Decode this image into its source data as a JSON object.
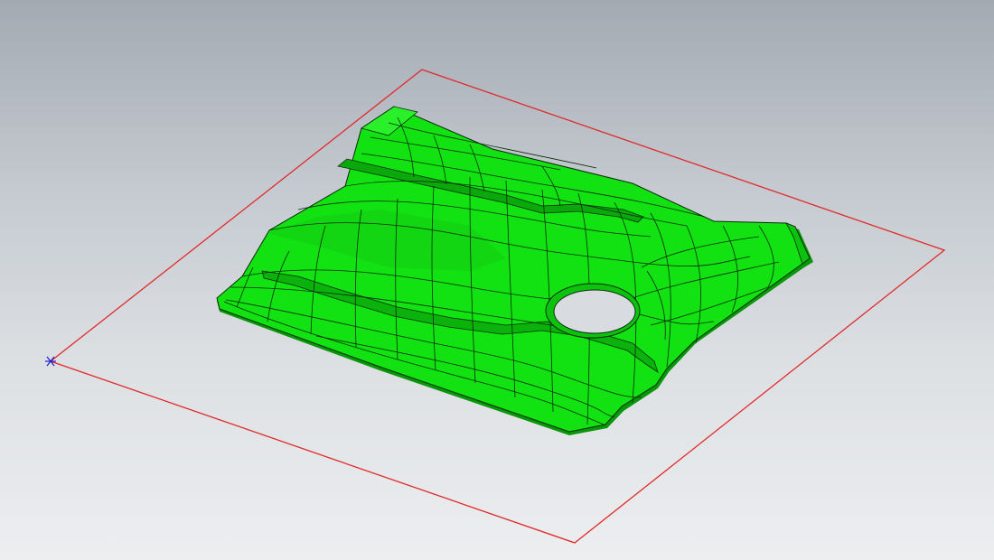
{
  "viewport": {
    "background_top": "#a3aab3",
    "background_bottom": "#eceef0"
  },
  "scene": {
    "datum_plane_color": "#e02a2a",
    "origin_marker_icon": "asterisk-triad-icon",
    "origin_marker_color": "#1f1fd0",
    "part_surface_color": "#12e112",
    "part_shadow_color": "#089708",
    "patch_edge_color": "#0c2a0c",
    "hole_fill_color": "#d8dbdf"
  }
}
